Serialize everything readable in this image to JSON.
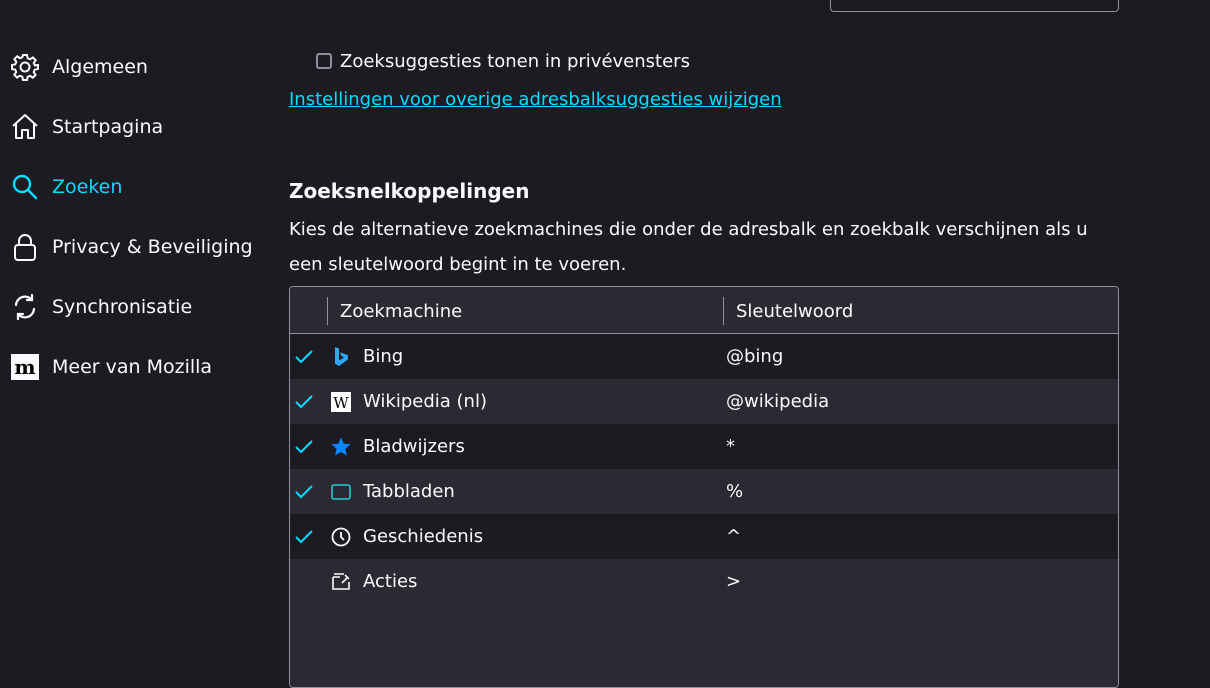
{
  "sidebar": {
    "items": [
      {
        "label": "Algemeen",
        "icon": "gear-icon"
      },
      {
        "label": "Startpagina",
        "icon": "home-icon"
      },
      {
        "label": "Zoeken",
        "icon": "search-icon",
        "active": true
      },
      {
        "label": "Privacy & Beveiliging",
        "icon": "lock-icon"
      },
      {
        "label": "Synchronisatie",
        "icon": "sync-icon"
      },
      {
        "label": "Meer van Mozilla",
        "icon": "mozilla-icon"
      }
    ]
  },
  "main": {
    "private_suggestions": {
      "label": "Zoeksuggesties tonen in privévensters",
      "checked": false
    },
    "address_bar_link": "Instellingen voor overige adresbalksuggesties wijzigen",
    "shortcuts": {
      "title": "Zoeksnelkoppelingen",
      "description": "Kies de alternatieve zoekmachines die onder de adresbalk en zoekbalk verschijnen als u een sleutelwoord begint in te voeren.",
      "columns": [
        "Zoekmachine",
        "Sleutelwoord"
      ],
      "rows": [
        {
          "name": "Bing",
          "keyword": "@bing",
          "checked": true,
          "icon": "bing-icon"
        },
        {
          "name": "Wikipedia (nl)",
          "keyword": "@wikipedia",
          "checked": true,
          "icon": "wikipedia-icon"
        },
        {
          "name": "Bladwijzers",
          "keyword": "*",
          "checked": true,
          "icon": "star-icon"
        },
        {
          "name": "Tabbladen",
          "keyword": "%",
          "checked": true,
          "icon": "tab-icon"
        },
        {
          "name": "Geschiedenis",
          "keyword": "^",
          "checked": true,
          "icon": "clock-icon"
        },
        {
          "name": "Acties",
          "keyword": ">",
          "checked": false,
          "icon": "actions-icon"
        }
      ]
    }
  },
  "colors": {
    "accent": "#00ddff",
    "background": "#1c1b22",
    "row_alt": "#2b2a33",
    "border": "#8f8f9d",
    "text": "#fbfbfe"
  }
}
